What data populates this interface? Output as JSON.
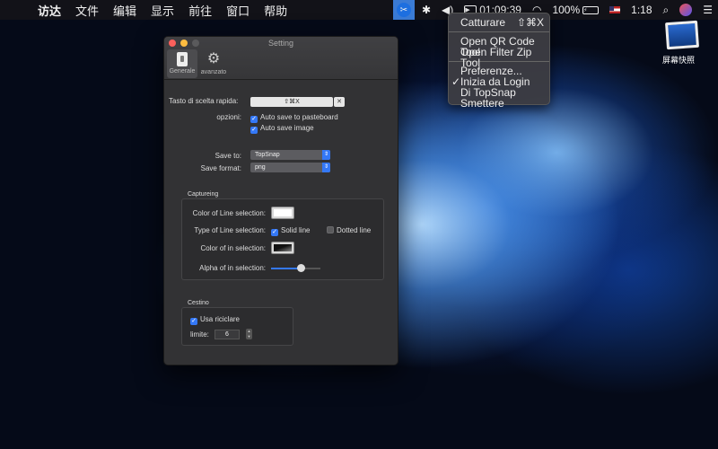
{
  "menubar": {
    "apple": "",
    "menus": [
      "访达",
      "文件",
      "编辑",
      "显示",
      "前往",
      "窗口",
      "帮助"
    ],
    "time_recording": "01:09:39",
    "battery_percent": "100%",
    "clock": "1:18"
  },
  "dropdown": {
    "items": [
      {
        "label": "Catturare",
        "shortcut": "⇧⌘X"
      },
      {
        "label": "Open QR Code Tool"
      },
      {
        "label": "Open Filter Zip Tool"
      },
      {
        "label": "Preferenze..."
      },
      {
        "label": "Inizia da Login",
        "checked": true
      },
      {
        "label": "Di TopSnap"
      },
      {
        "label": "Smettere"
      }
    ]
  },
  "desktop_icon": {
    "label": "屏幕快照"
  },
  "window": {
    "title": "Setting",
    "tabs": [
      {
        "label": "Generale",
        "icon": "switch-icon"
      },
      {
        "label": "avanzato",
        "icon": "gear-icon"
      }
    ],
    "shortcut_label": "Tasto di scelta rapida:",
    "shortcut_value": "⇧⌘X",
    "clear_glyph": "✕",
    "options_label": "opzioni:",
    "opt_auto_pasteboard": "Auto save to pasteboard",
    "opt_auto_image": "Auto save image",
    "save_to_label": "Save to:",
    "save_to_value": "TopSnap",
    "save_format_label": "Save format:",
    "save_format_value": "png",
    "capture_group_title": "Captureing",
    "color_line_label": "Color of Line selection:",
    "type_line_label": "Type of Line selection:",
    "solid_line": "Solid line",
    "dotted_line": "Dotted line",
    "color_in_label": "Color of in selection:",
    "alpha_in_label": "Alpha of in selection:",
    "alpha_value": 0.6,
    "trash_group_title": "Cestino",
    "use_recycle": "Usa riciclare",
    "limit_label": "limite:",
    "limit_value": "6"
  }
}
